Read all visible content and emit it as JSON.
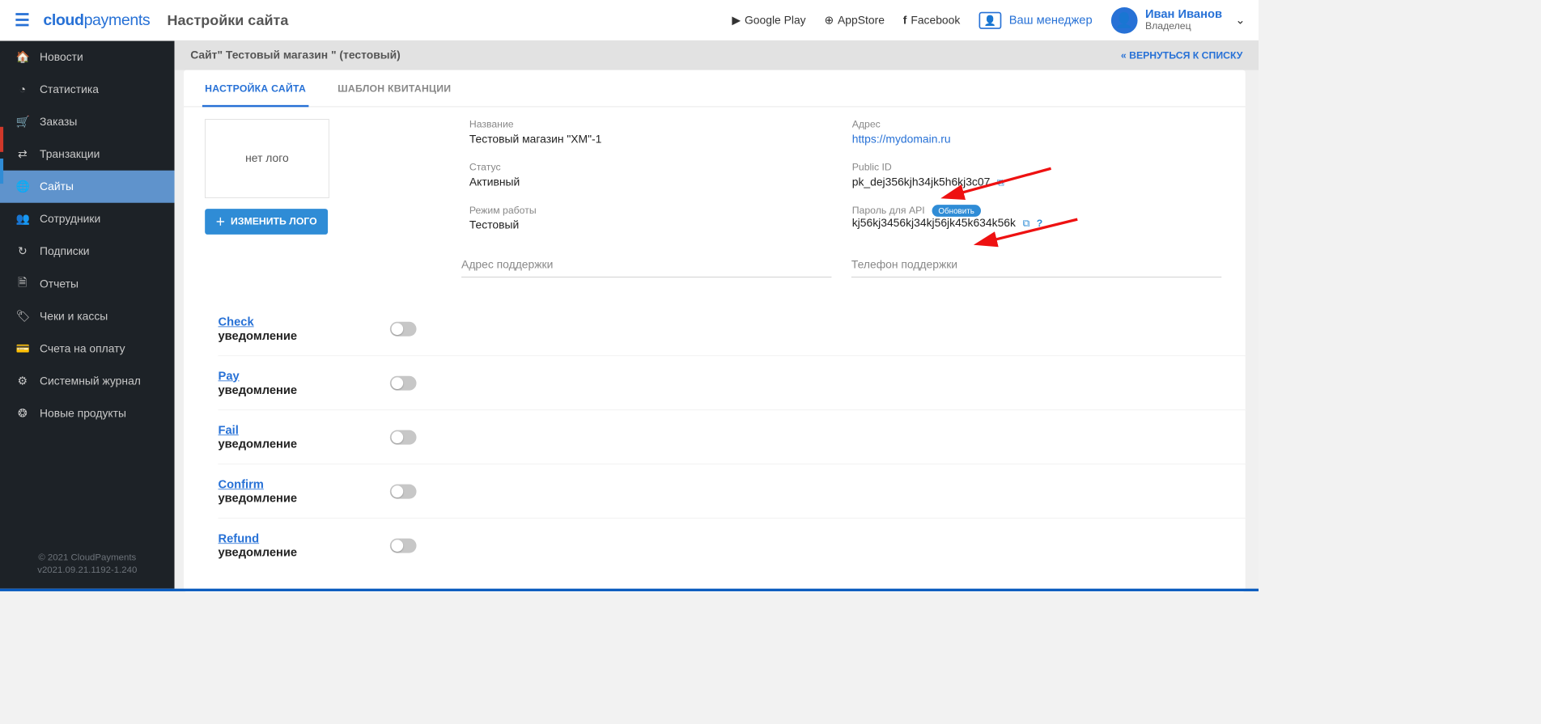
{
  "header": {
    "page_title": "Настройки сайта",
    "links": {
      "google_play": "Google Play",
      "appstore": "AppStore",
      "facebook": "Facebook"
    },
    "manager_label": "Ваш менеджер",
    "user": {
      "name": "Иван Иванов",
      "role": "Владелец"
    }
  },
  "logo": {
    "bold": "cloud",
    "light": "payments"
  },
  "sidebar": {
    "items": [
      {
        "icon": "🏠",
        "label": "Новости"
      },
      {
        "icon": "◔",
        "label": "Статистика"
      },
      {
        "icon": "🛒",
        "label": "Заказы"
      },
      {
        "icon": "⇄",
        "label": "Транзакции"
      },
      {
        "icon": "🌐",
        "label": "Сайты",
        "active": true
      },
      {
        "icon": "👥",
        "label": "Сотрудники"
      },
      {
        "icon": "↻",
        "label": "Подписки"
      },
      {
        "icon": "🗎",
        "label": "Отчеты"
      },
      {
        "icon": "🏷",
        "label": "Чеки и кассы"
      },
      {
        "icon": "💳",
        "label": "Счета на оплату"
      },
      {
        "icon": "⚙",
        "label": "Системный журнал"
      },
      {
        "icon": "❂",
        "label": "Новые продукты"
      }
    ],
    "copyright": "© 2021 CloudPayments",
    "version": "v2021.09.21.1192-1.240"
  },
  "crumb": {
    "title": "Сайт\" Тестовый магазин \" (тестовый)",
    "back": "ВЕРНУТЬСЯ К СПИСКУ"
  },
  "tabs": {
    "settings": "НАСТРОЙКА САЙТА",
    "template": "ШАБЛОН КВИТАНЦИИ"
  },
  "site": {
    "no_logo": "нет лого",
    "change_logo": "ИЗМЕНИТЬ ЛОГО",
    "name_label": "Название",
    "name_value": "Тестовый магазин \"XM\"-1",
    "status_label": "Статус",
    "status_value": "Активный",
    "mode_label": "Режим работы",
    "mode_value": "Тестовый",
    "address_label": "Адрес",
    "address_value": "https://mydomain.ru",
    "public_id_label": "Public ID",
    "public_id_value": "pk_dej356kjh34jk5h6kj3c07",
    "api_pw_label": "Пароль для API",
    "api_pw_refresh": "Обновить",
    "api_pw_value": "kj56kj3456kj34kj56jk45k634k56k",
    "support_addr_ph": "Адрес поддержки",
    "support_phone_ph": "Телефон поддержки"
  },
  "notifications": {
    "sub": "уведомление",
    "items": [
      "Check",
      "Pay",
      "Fail",
      "Confirm",
      "Refund"
    ]
  }
}
